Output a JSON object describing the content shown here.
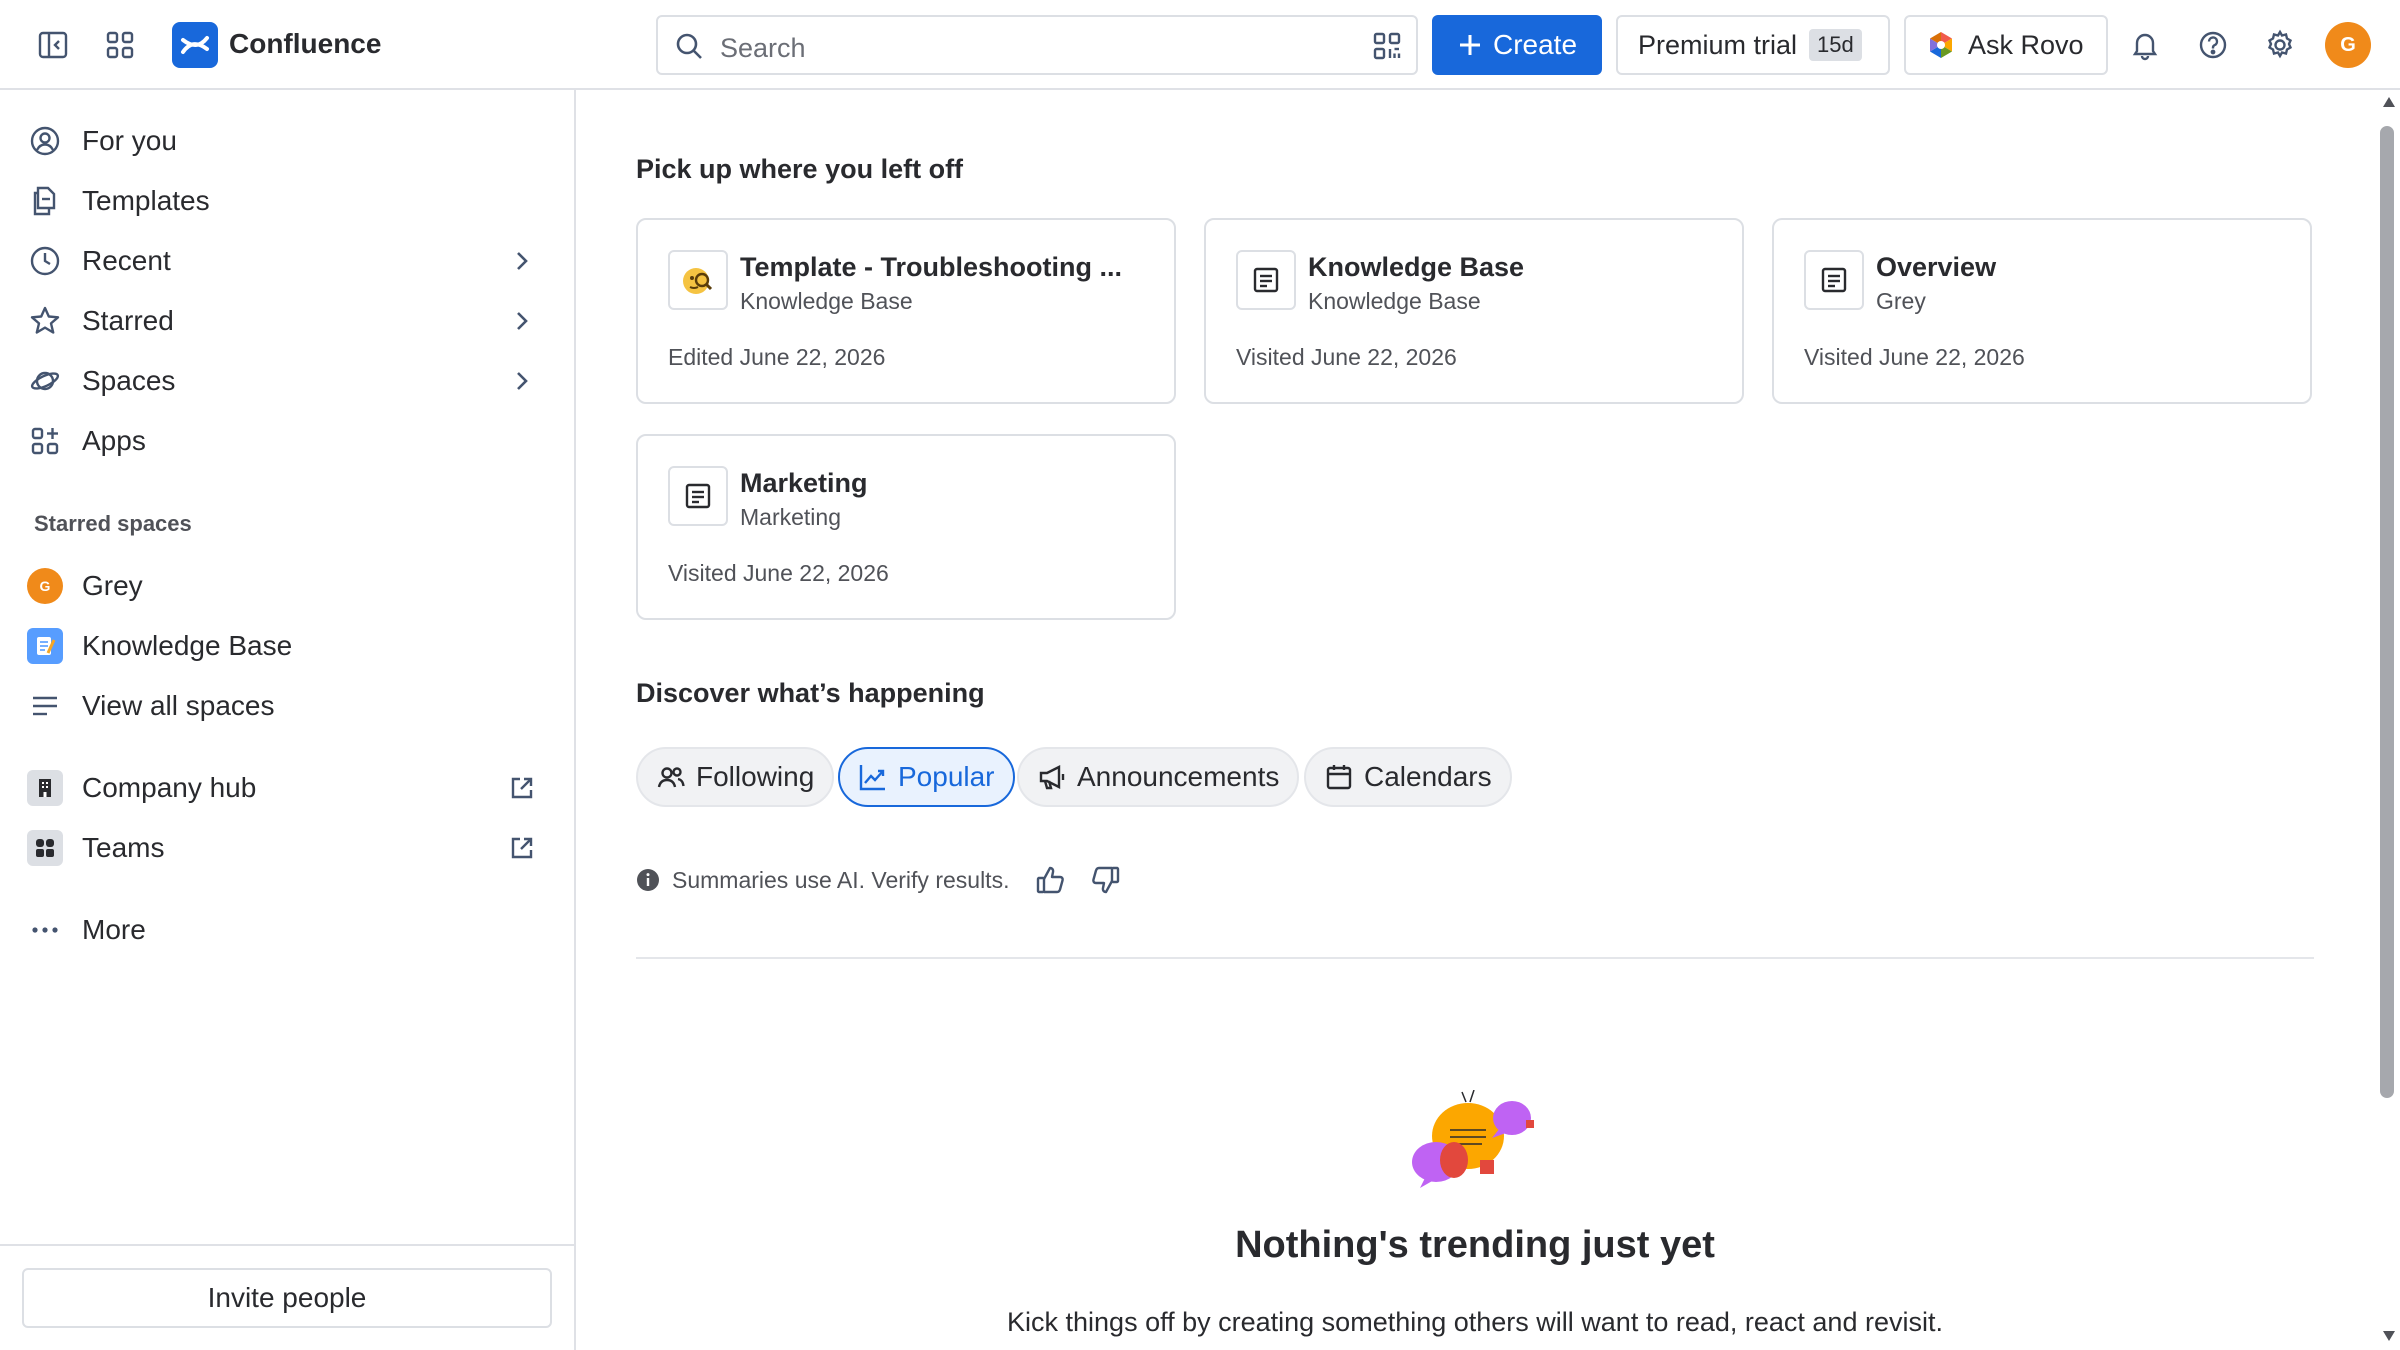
{
  "topbar": {
    "app_name": "Confluence",
    "search_placeholder": "Search",
    "create_label": "Create",
    "premium_label": "Premium trial",
    "premium_badge": "15d",
    "ask_rovo_label": "Ask Rovo",
    "avatar_initial": "G"
  },
  "sidebar": {
    "nav": [
      {
        "label": "For you",
        "icon": "user-circle-icon"
      },
      {
        "label": "Templates",
        "icon": "templates-icon"
      },
      {
        "label": "Recent",
        "icon": "clock-icon"
      },
      {
        "label": "Starred",
        "icon": "star-icon"
      },
      {
        "label": "Spaces",
        "icon": "planet-icon"
      },
      {
        "label": "Apps",
        "icon": "apps-icon"
      }
    ],
    "starred_heading": "Starred spaces",
    "spaces": [
      {
        "label": "Grey",
        "initial": "G"
      },
      {
        "label": "Knowledge Base"
      }
    ],
    "view_all": "View all spaces",
    "company_hub": "Company hub",
    "teams": "Teams",
    "more": "More",
    "invite": "Invite people"
  },
  "main": {
    "pickup_heading": "Pick up where you left off",
    "cards": [
      {
        "title": "Template - Troubleshooting ...",
        "space": "Knowledge Base",
        "meta": "Edited June 22, 2026"
      },
      {
        "title": "Knowledge Base",
        "space": "Knowledge Base",
        "meta": "Visited June 22, 2026"
      },
      {
        "title": "Overview",
        "space": "Grey",
        "meta": "Visited June 22, 2026"
      },
      {
        "title": "Marketing",
        "space": "Marketing",
        "meta": "Visited June 22, 2026"
      }
    ],
    "discover_heading": "Discover what’s happening",
    "chips": [
      {
        "label": "Following"
      },
      {
        "label": "Popular"
      },
      {
        "label": "Announcements"
      },
      {
        "label": "Calendars"
      }
    ],
    "ai_note": "Summaries use AI. Verify results.",
    "empty_title": "Nothing's trending just yet",
    "empty_text": "Kick things off by creating something others will want to read, react and revisit."
  },
  "colors": {
    "brand_blue": "#1868db",
    "avatar_orange": "#f08a1a",
    "border": "#dcdfe4"
  }
}
